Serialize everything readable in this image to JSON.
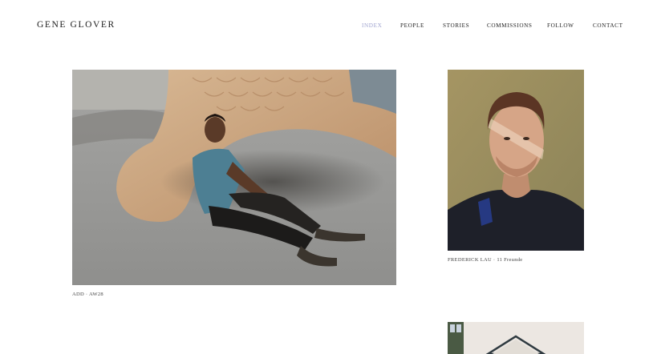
{
  "header": {
    "logo": "GENE GLOVER",
    "nav": [
      {
        "label": "INDEX",
        "active": true
      },
      {
        "label": "PEOPLE",
        "active": false
      },
      {
        "label": "STORIES",
        "active": false
      },
      {
        "label": "COMMISSIONS",
        "active": false
      },
      {
        "label": "FOLLOW",
        "active": false
      },
      {
        "label": "CONTACT",
        "active": false
      }
    ],
    "active_color": "#9fa3cf"
  },
  "gallery": [
    {
      "caption": "ADD · AW28"
    },
    {
      "caption": "FREDERICK LAU · 11 Freunde"
    },
    {
      "caption": ""
    }
  ]
}
